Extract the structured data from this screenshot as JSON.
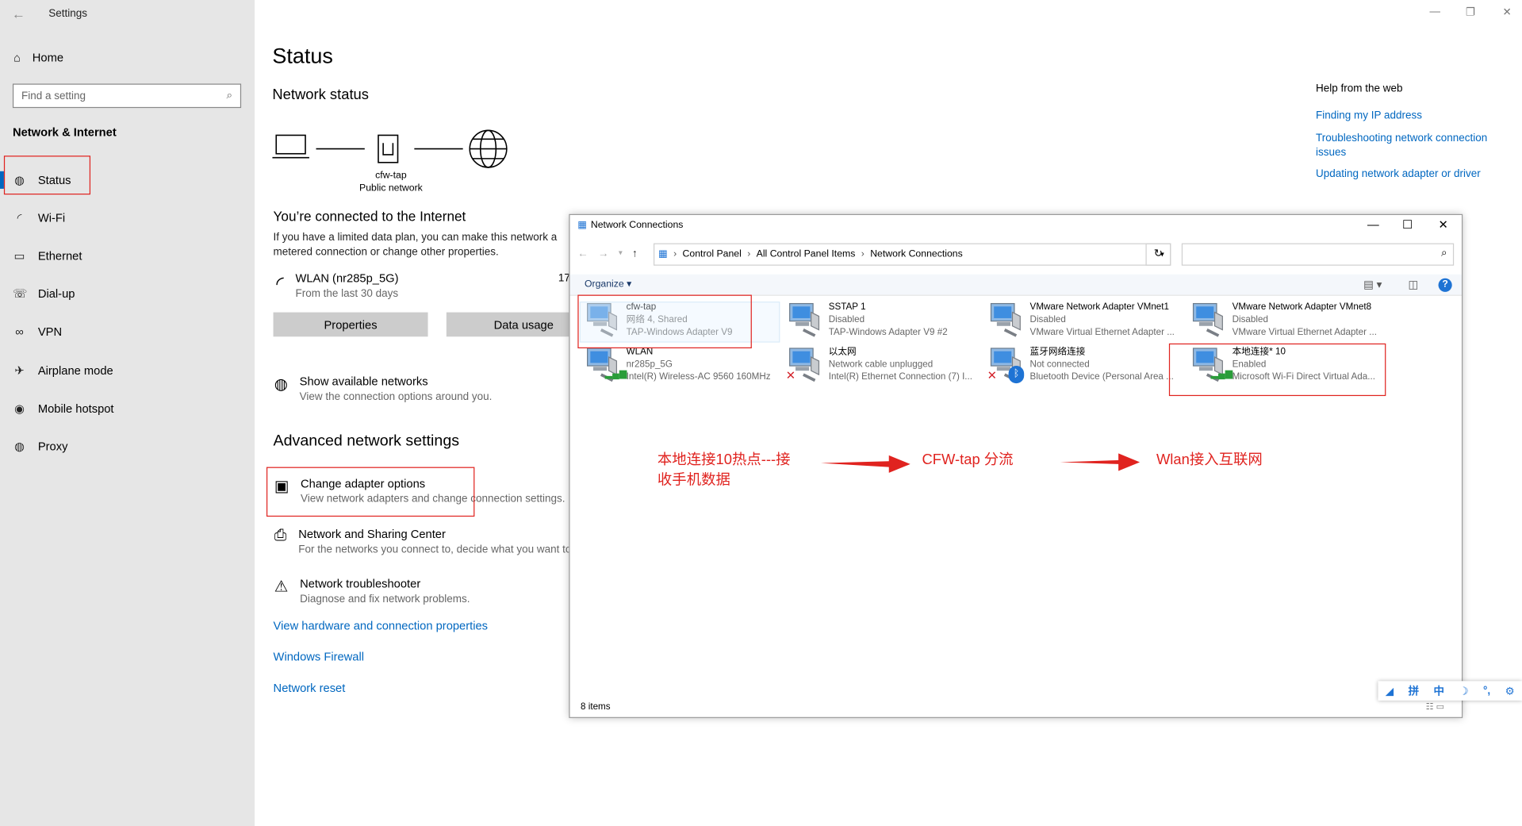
{
  "settings": {
    "app_title": "Settings",
    "home_label": "Home",
    "search_placeholder": "Find a setting",
    "section": "Network & Internet",
    "nav": [
      {
        "label": "Status",
        "icon": "globe-icon"
      },
      {
        "label": "Wi-Fi",
        "icon": "wifi-icon"
      },
      {
        "label": "Ethernet",
        "icon": "ethernet-icon"
      },
      {
        "label": "Dial-up",
        "icon": "dialup-icon"
      },
      {
        "label": "VPN",
        "icon": "vpn-icon"
      },
      {
        "label": "Airplane mode",
        "icon": "airplane-icon"
      },
      {
        "label": "Mobile hotspot",
        "icon": "hotspot-icon"
      },
      {
        "label": "Proxy",
        "icon": "globe-icon"
      }
    ]
  },
  "main": {
    "title": "Status",
    "network_status": "Network status",
    "diagram_label_1": "cfw-tap",
    "diagram_label_2": "Public network",
    "connected": "You’re connected to the Internet",
    "limited_text": "If you have a limited data plan, you can make this network a metered connection or change other properties.",
    "wlan_name": "WLAN (nr285p_5G)",
    "wlan_sub": "From the last 30 days",
    "wlan_num": "17",
    "btn_properties": "Properties",
    "btn_data_usage": "Data usage",
    "show_networks": "Show available networks",
    "show_networks_sub": "View the connection options around you.",
    "advanced": "Advanced network settings",
    "change_adapter": "Change adapter options",
    "change_adapter_sub": "View network adapters and change connection settings.",
    "sharing_center": "Network and Sharing Center",
    "sharing_center_sub": "For the networks you connect to, decide what you want to",
    "troubleshooter": "Network troubleshooter",
    "troubleshooter_sub": "Diagnose and fix network problems.",
    "link_hardware": "View hardware and connection properties",
    "link_firewall": "Windows Firewall",
    "link_reset": "Network reset"
  },
  "help": {
    "title": "Help from the web",
    "links": [
      "Finding my IP address",
      "Troubleshooting network connection issues",
      "Updating network adapter or driver"
    ]
  },
  "nc_window": {
    "title": "Network Connections",
    "breadcrumb": [
      "Control Panel",
      "All Control Panel Items",
      "Network Connections"
    ],
    "organize": "Organize",
    "status": "8 items",
    "adapters": [
      {
        "name": "cfw-tap",
        "status": "网络 4, Shared",
        "device": "TAP-Windows Adapter V9"
      },
      {
        "name": "SSTAP 1",
        "status": "Disabled",
        "device": "TAP-Windows Adapter V9 #2"
      },
      {
        "name": "VMware Network Adapter VMnet1",
        "status": "Disabled",
        "device": "VMware Virtual Ethernet Adapter ..."
      },
      {
        "name": "VMware Network Adapter VMnet8",
        "status": "Disabled",
        "device": "VMware Virtual Ethernet Adapter ..."
      },
      {
        "name": "WLAN",
        "status": "nr285p_5G",
        "device": "Intel(R) Wireless-AC 9560 160MHz"
      },
      {
        "name": "以太网",
        "status": "Network cable unplugged",
        "device": "Intel(R) Ethernet Connection (7) I..."
      },
      {
        "name": "蓝牙网络连接",
        "status": "Not connected",
        "device": "Bluetooth Device (Personal Area ..."
      },
      {
        "name": "本地连接* 10",
        "status": "Enabled",
        "device": "Microsoft Wi-Fi Direct Virtual Ada..."
      }
    ]
  },
  "annotations": {
    "a1_line1": "本地连接10热点---接",
    "a1_line2": "收手机数据",
    "a2": "CFW-tap 分流",
    "a3": "Wlan接入互联网"
  },
  "ime": [
    "拼",
    "中"
  ],
  "colors": {
    "accent": "#0067c0",
    "annotation": "#e0231f",
    "sidebar": "#e6e6e6"
  }
}
